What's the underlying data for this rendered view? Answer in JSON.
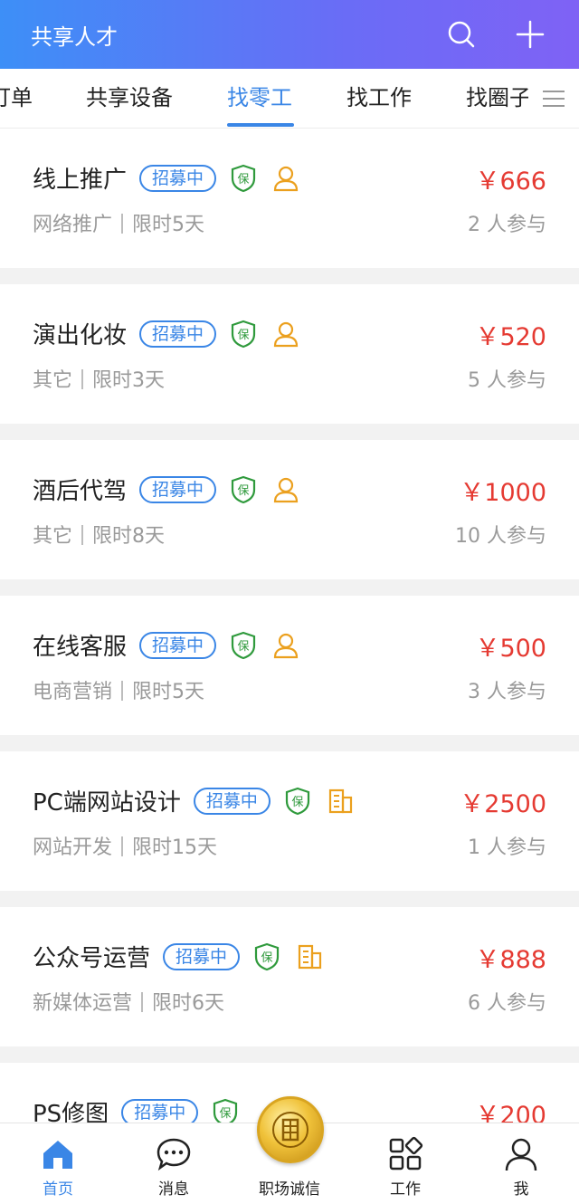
{
  "header": {
    "title": "共享人才"
  },
  "tabs": [
    {
      "label": "订单",
      "active": false
    },
    {
      "label": "共享设备",
      "active": false
    },
    {
      "label": "找零工",
      "active": true
    },
    {
      "label": "找工作",
      "active": false
    },
    {
      "label": "找圈子",
      "active": false
    }
  ],
  "colors": {
    "accent": "#3a86e6",
    "price": "#e53a32",
    "shield": "#2f9a3c",
    "person": "#eba01e"
  },
  "jobs": [
    {
      "title": "线上推广",
      "status": "招募中",
      "icon": "person-icon",
      "category": "网络推广",
      "duration": "限时5天",
      "price": "￥666",
      "participants": "2 人参与"
    },
    {
      "title": "演出化妆",
      "status": "招募中",
      "icon": "person-icon",
      "category": "其它",
      "duration": "限时3天",
      "price": "￥520",
      "participants": "5 人参与"
    },
    {
      "title": "酒后代驾",
      "status": "招募中",
      "icon": "person-icon",
      "category": "其它",
      "duration": "限时8天",
      "price": "￥1000",
      "participants": "10 人参与"
    },
    {
      "title": "在线客服",
      "status": "招募中",
      "icon": "person-icon",
      "category": "电商营销",
      "duration": "限时5天",
      "price": "￥500",
      "participants": "3 人参与"
    },
    {
      "title": "PC端网站设计",
      "status": "招募中",
      "icon": "building-icon",
      "category": "网站开发",
      "duration": "限时15天",
      "price": "￥2500",
      "participants": "1 人参与"
    },
    {
      "title": "公众号运营",
      "status": "招募中",
      "icon": "building-icon",
      "category": "新媒体运营",
      "duration": "限时6天",
      "price": "￥888",
      "participants": "6 人参与"
    },
    {
      "title": "PS修图",
      "status": "招募中",
      "icon": "shield-icon",
      "category": "",
      "duration": "",
      "price": "￥200",
      "participants": ""
    }
  ],
  "bottom_nav": [
    {
      "label": "首页",
      "icon": "home-icon",
      "active": true
    },
    {
      "label": "消息",
      "icon": "message-icon",
      "active": false
    },
    {
      "label": "职场诚信",
      "icon": "integrity-coin-icon",
      "active": false
    },
    {
      "label": "工作",
      "icon": "apps-icon",
      "active": false
    },
    {
      "label": "我",
      "icon": "profile-icon",
      "active": false
    }
  ]
}
